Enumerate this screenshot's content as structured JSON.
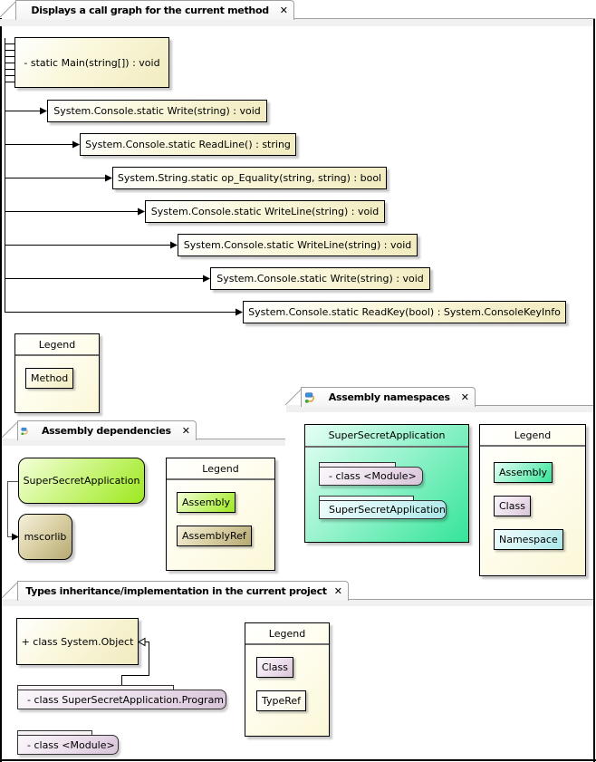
{
  "call_graph": {
    "tab_title": "Displays a call graph for the current method",
    "close_glyph": "✕",
    "icon": "diagram-icon",
    "root_method": "- static  Main(string[]) : void",
    "callees": [
      "System.Console.static  Write(string) : void",
      "System.Console.static  ReadLine() : string",
      "System.String.static  op_Equality(string, string) : bool",
      "System.Console.static  WriteLine(string) : void",
      "System.Console.static  WriteLine(string) : void",
      "System.Console.static  Write(string) : void",
      "System.Console.static  ReadKey(bool) : System.ConsoleKeyInfo"
    ],
    "legend": {
      "title": "Legend",
      "items": [
        "Method"
      ]
    }
  },
  "assembly_dependencies": {
    "tab_title": "Assembly dependencies",
    "close_glyph": "✕",
    "icon": "diagram-icon",
    "assembly": "SuperSecretApplication",
    "reference": "mscorlib",
    "legend": {
      "title": "Legend",
      "items": [
        "Assembly",
        "AssemblyRef"
      ]
    }
  },
  "assembly_namespaces": {
    "tab_title": "Assembly namespaces",
    "close_glyph": "✕",
    "icon": "diagram-icon",
    "assembly": "SuperSecretApplication",
    "members": [
      "- class <Module>",
      "SuperSecretApplication"
    ],
    "legend": {
      "title": "Legend",
      "items": [
        "Assembly",
        "Class",
        "Namespace"
      ]
    }
  },
  "types_inheritance": {
    "tab_title": "Types inheritance/implementation in the current project",
    "close_glyph": "✕",
    "icon": "diagram-icon",
    "base_type": "+ class System.Object",
    "derived_type": "- class SuperSecretApplication.Program",
    "module_class": "- class <Module>",
    "legend": {
      "title": "Legend",
      "items": [
        "Class",
        "TypeRef"
      ]
    }
  }
}
